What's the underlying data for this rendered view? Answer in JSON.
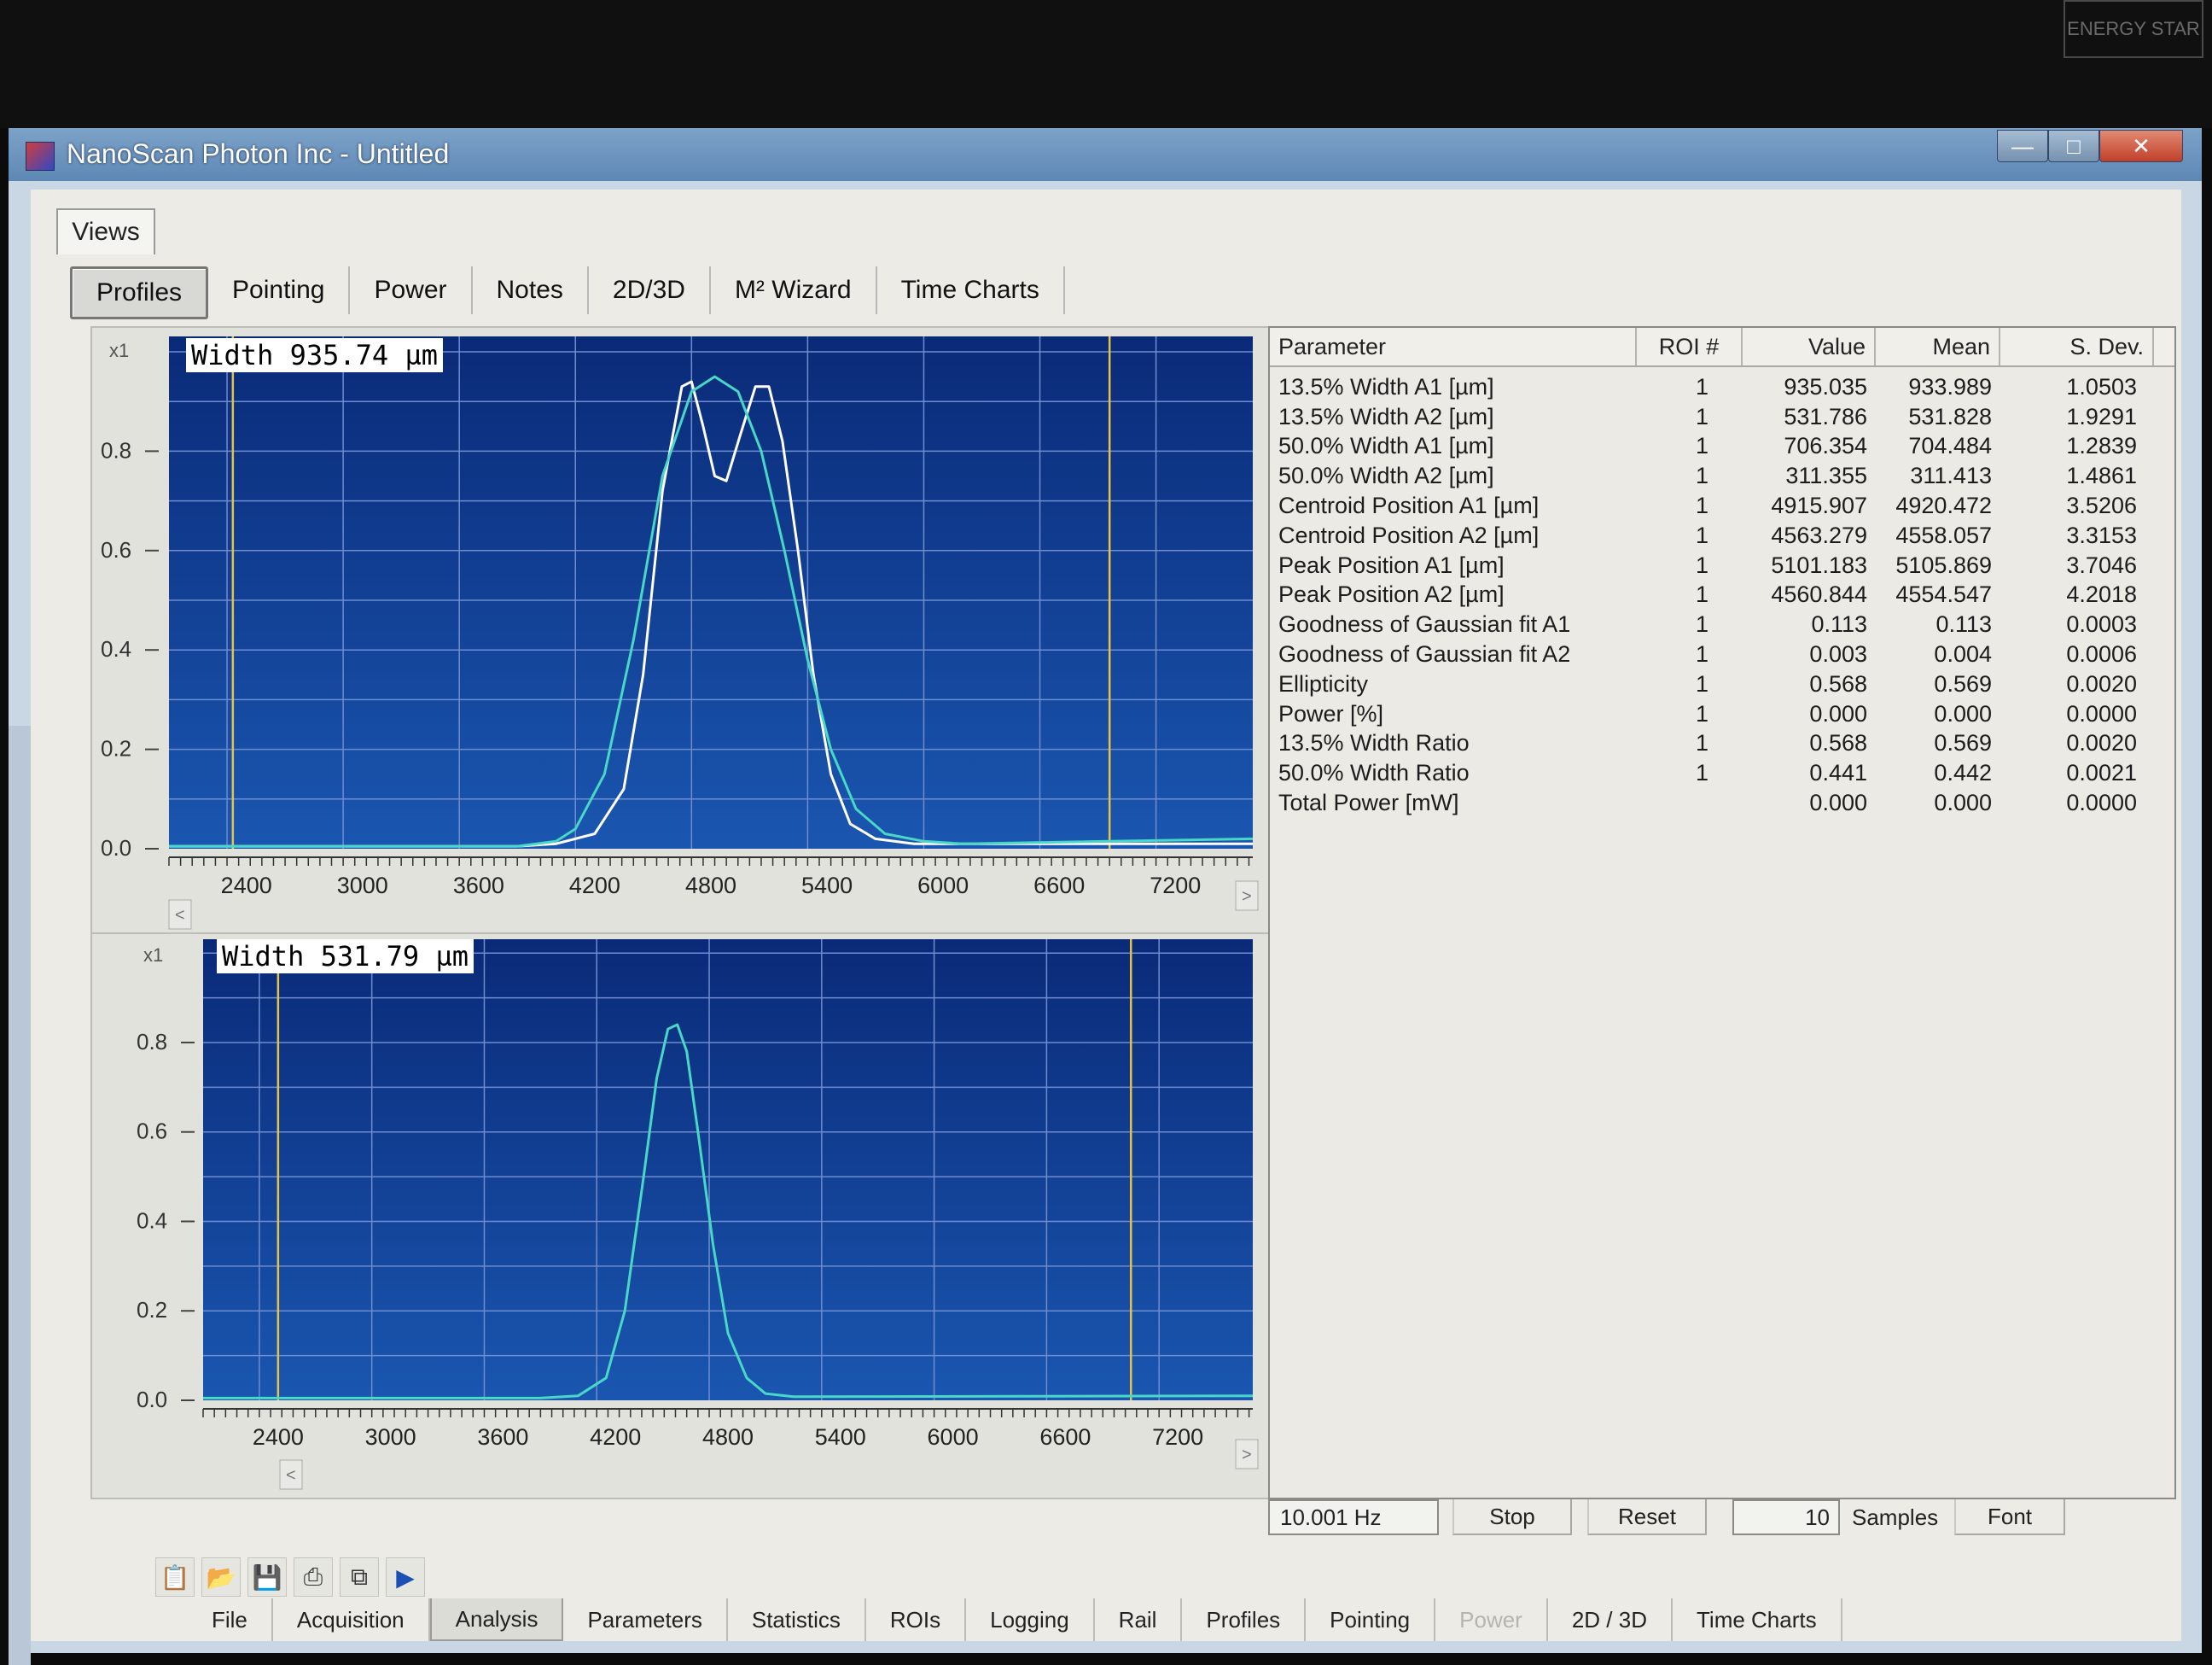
{
  "window": {
    "title": "NanoScan Photon Inc - Untitled",
    "minimize_label": "—",
    "maximize_label": "□",
    "close_label": "✕"
  },
  "bezel": {
    "badge": "ENERGY STAR"
  },
  "views_label": "Views",
  "top_tabs": [
    "Profiles",
    "Pointing",
    "Power",
    "Notes",
    "2D/3D",
    "M² Wizard",
    "Time Charts"
  ],
  "plot_a": {
    "multiplier": "x1",
    "width_label": "Width 935.74 µm",
    "yticks": [
      "0.8",
      "0.6",
      "0.4",
      "0.2",
      "0.0"
    ],
    "xticks": [
      "2400",
      "3000",
      "3600",
      "4200",
      "4800",
      "5400",
      "6000",
      "6600",
      "7200"
    ],
    "scroll_left": "<",
    "scroll_right": ">"
  },
  "plot_b": {
    "multiplier": "x1",
    "width_label": "Width 531.79 µm",
    "yticks": [
      "0.8",
      "0.6",
      "0.4",
      "0.2",
      "0.0"
    ],
    "xticks": [
      "2400",
      "3000",
      "3600",
      "4200",
      "4800",
      "5400",
      "6000",
      "6600",
      "7200"
    ],
    "scroll_left": "<",
    "scroll_right": ">"
  },
  "stats": {
    "headers": [
      "Parameter",
      "ROI #",
      "Value",
      "Mean",
      "S. Dev."
    ],
    "rows": [
      [
        "13.5% Width A1 [µm]",
        "1",
        "935.035",
        "933.989",
        "1.0503"
      ],
      [
        "13.5% Width A2 [µm]",
        "1",
        "531.786",
        "531.828",
        "1.9291"
      ],
      [
        "50.0% Width A1 [µm]",
        "1",
        "706.354",
        "704.484",
        "1.2839"
      ],
      [
        "50.0% Width A2 [µm]",
        "1",
        "311.355",
        "311.413",
        "1.4861"
      ],
      [
        "Centroid Position A1 [µm]",
        "1",
        "4915.907",
        "4920.472",
        "3.5206"
      ],
      [
        "Centroid Position A2 [µm]",
        "1",
        "4563.279",
        "4558.057",
        "3.3153"
      ],
      [
        "Peak Position A1 [µm]",
        "1",
        "5101.183",
        "5105.869",
        "3.7046"
      ],
      [
        "Peak Position A2 [µm]",
        "1",
        "4560.844",
        "4554.547",
        "4.2018"
      ],
      [
        "Goodness of Gaussian fit A1",
        "1",
        "0.113",
        "0.113",
        "0.0003"
      ],
      [
        "Goodness of Gaussian fit A2",
        "1",
        "0.003",
        "0.004",
        "0.0006"
      ],
      [
        "Ellipticity",
        "1",
        "0.568",
        "0.569",
        "0.0020"
      ],
      [
        "Power [%]",
        "1",
        "0.000",
        "0.000",
        "0.0000"
      ],
      [
        "13.5% Width Ratio",
        "1",
        "0.568",
        "0.569",
        "0.0020"
      ],
      [
        "50.0% Width Ratio",
        "1",
        "0.441",
        "0.442",
        "0.0021"
      ],
      [
        "Total Power [mW]",
        "",
        "0.000",
        "0.000",
        "0.0000"
      ]
    ],
    "frequency": "10.001 Hz",
    "stop_label": "Stop",
    "reset_label": "Reset",
    "samples_value": "10",
    "samples_label": "Samples",
    "font_label": "Font"
  },
  "toolbar_icons": [
    "clipboard-icon",
    "open-folder-icon",
    "save-icon",
    "print-icon",
    "copy-windows-icon",
    "play-icon"
  ],
  "bottom_tabs": [
    "File",
    "Acquisition",
    "Analysis",
    "Parameters",
    "Statistics",
    "ROIs",
    "Logging",
    "Rail",
    "Profiles",
    "Pointing",
    "Power",
    "2D / 3D",
    "Time Charts"
  ],
  "colors": {
    "plot_bg_top": "#0a2a78",
    "plot_bg_bottom": "#1a56b0",
    "grid": "#6e8cd0",
    "profile_white": "#ffffff",
    "profile_cyan": "#49d7c6",
    "clip_line": "#e6c24a"
  },
  "chart_data": [
    {
      "type": "line",
      "title": "Width 935.74 µm",
      "xlabel": "",
      "ylabel": "",
      "xlim": [
        2000,
        7600
      ],
      "ylim": [
        0,
        1.0
      ],
      "xticks": [
        2400,
        3000,
        3600,
        4200,
        4800,
        5400,
        6000,
        6600,
        7200
      ],
      "yticks": [
        0.0,
        0.2,
        0.4,
        0.6,
        0.8
      ],
      "grid": true,
      "clip_lines_x": [
        2330,
        6860
      ],
      "series": [
        {
          "name": "",
          "color": "#ffffff",
          "x": [
            2000,
            3800,
            4000,
            4200,
            4350,
            4450,
            4550,
            4650,
            4700,
            4760,
            4820,
            4880,
            4950,
            5030,
            5100,
            5170,
            5250,
            5330,
            5420,
            5520,
            5650,
            5850,
            7600
          ],
          "y": [
            0.005,
            0.005,
            0.01,
            0.03,
            0.12,
            0.35,
            0.72,
            0.93,
            0.94,
            0.85,
            0.75,
            0.74,
            0.83,
            0.93,
            0.93,
            0.82,
            0.6,
            0.35,
            0.15,
            0.05,
            0.02,
            0.01,
            0.01
          ]
        },
        {
          "name": "",
          "color": "#49d7c6",
          "x": [
            2000,
            3800,
            4000,
            4100,
            4250,
            4400,
            4550,
            4700,
            4820,
            4940,
            5060,
            5180,
            5300,
            5420,
            5550,
            5700,
            5900,
            6100,
            7600
          ],
          "y": [
            0.005,
            0.005,
            0.015,
            0.04,
            0.15,
            0.42,
            0.75,
            0.92,
            0.95,
            0.92,
            0.8,
            0.6,
            0.38,
            0.2,
            0.08,
            0.03,
            0.015,
            0.01,
            0.02
          ]
        }
      ]
    },
    {
      "type": "line",
      "title": "Width 531.79 µm",
      "xlabel": "",
      "ylabel": "",
      "xlim": [
        2000,
        7600
      ],
      "ylim": [
        0,
        1.0
      ],
      "xticks": [
        2400,
        3000,
        3600,
        4200,
        4800,
        5400,
        6000,
        6600,
        7200
      ],
      "yticks": [
        0.0,
        0.2,
        0.4,
        0.6,
        0.8
      ],
      "grid": true,
      "clip_lines_x": [
        2400,
        6950
      ],
      "series": [
        {
          "name": "",
          "color": "#49d7c6",
          "x": [
            2000,
            3800,
            4000,
            4150,
            4250,
            4350,
            4420,
            4480,
            4530,
            4580,
            4640,
            4720,
            4800,
            4900,
            5000,
            5150,
            7600
          ],
          "y": [
            0.005,
            0.005,
            0.01,
            0.05,
            0.2,
            0.5,
            0.72,
            0.83,
            0.84,
            0.78,
            0.6,
            0.35,
            0.15,
            0.05,
            0.015,
            0.008,
            0.01
          ]
        }
      ]
    }
  ]
}
